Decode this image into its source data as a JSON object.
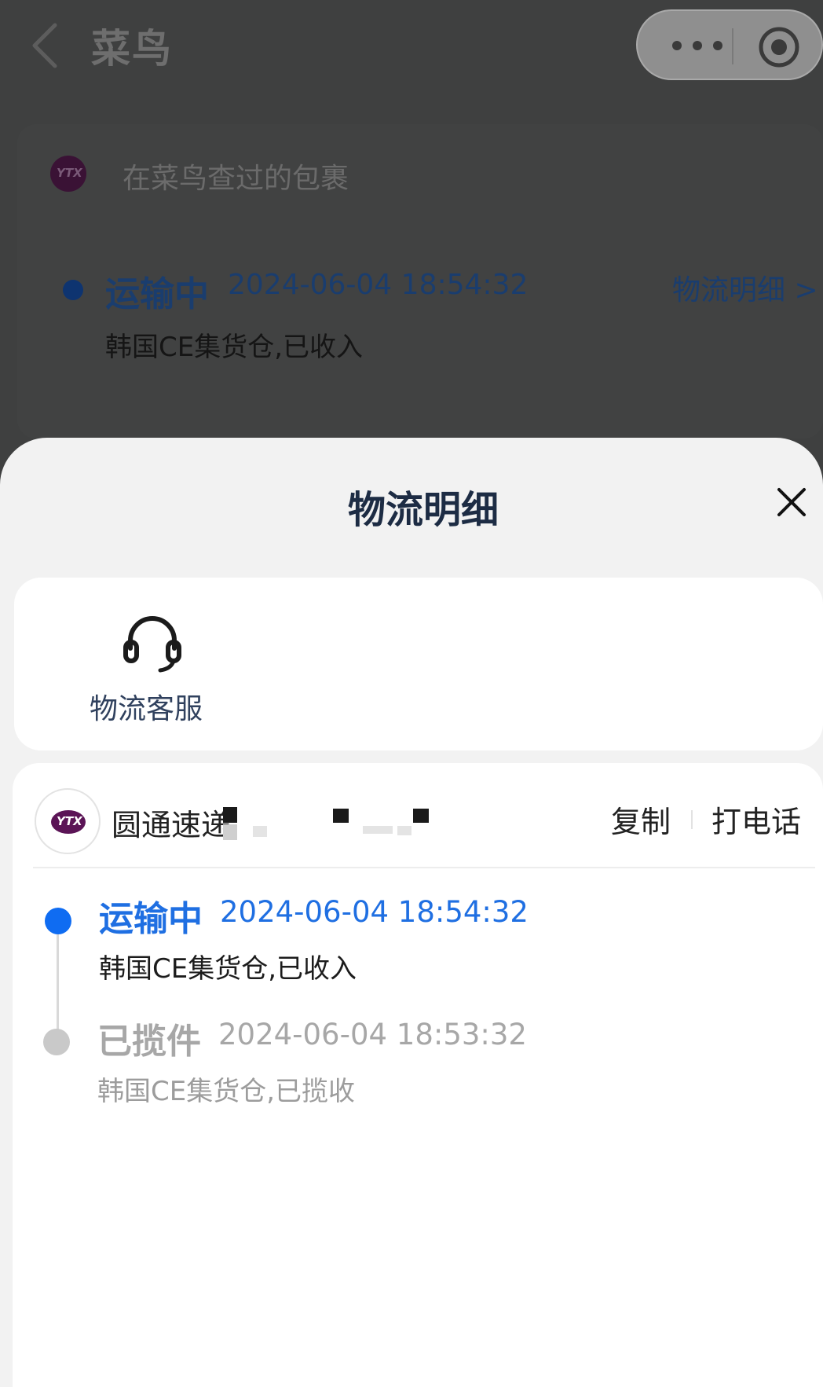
{
  "nav": {
    "title": "菜鸟"
  },
  "background_card": {
    "logo_text": "YTX",
    "history_label": "在菜鸟查过的包裹",
    "status": "运输中",
    "time": "2024-06-04 18:54:32",
    "detail_link": "物流明细 >",
    "description": "韩国CE集货仓,已收入"
  },
  "sheet": {
    "title": "物流明细",
    "service": {
      "label": "物流客服",
      "icon": "headset-icon"
    },
    "carrier": {
      "logo_text": "YTX",
      "name": "圆通速递",
      "copy_label": "复制",
      "call_label": "打电话"
    },
    "timeline": [
      {
        "status": "运输中",
        "time": "2024-06-04 18:54:32",
        "description": "韩国CE集货仓,已收入",
        "state": "active"
      },
      {
        "status": "已揽件",
        "time": "2024-06-04 18:53:32",
        "description": "韩国CE集货仓,已揽收",
        "state": "done"
      }
    ]
  },
  "colors": {
    "accent": "#1f6fe2",
    "overlay": "#3f4040",
    "sheet_background": "#f2f2f2"
  }
}
